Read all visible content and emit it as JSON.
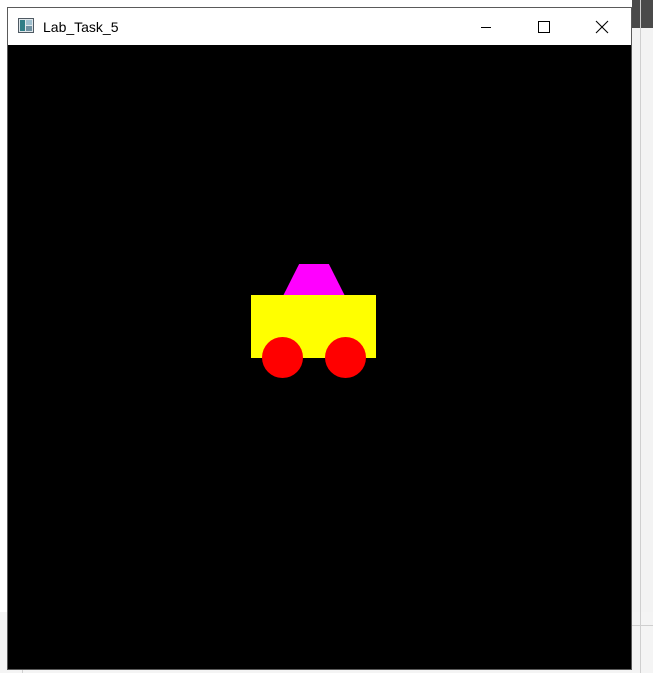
{
  "window": {
    "title": "Lab_Task_5",
    "controls": {
      "minimize_icon": "minimize-icon",
      "maximize_icon": "maximize-icon",
      "close_icon": "close-icon"
    }
  },
  "scene": {
    "background_color": "#000000",
    "cabin_color": "#ff00ff",
    "body_color": "#ffff00",
    "wheel_color": "#ff0000"
  }
}
